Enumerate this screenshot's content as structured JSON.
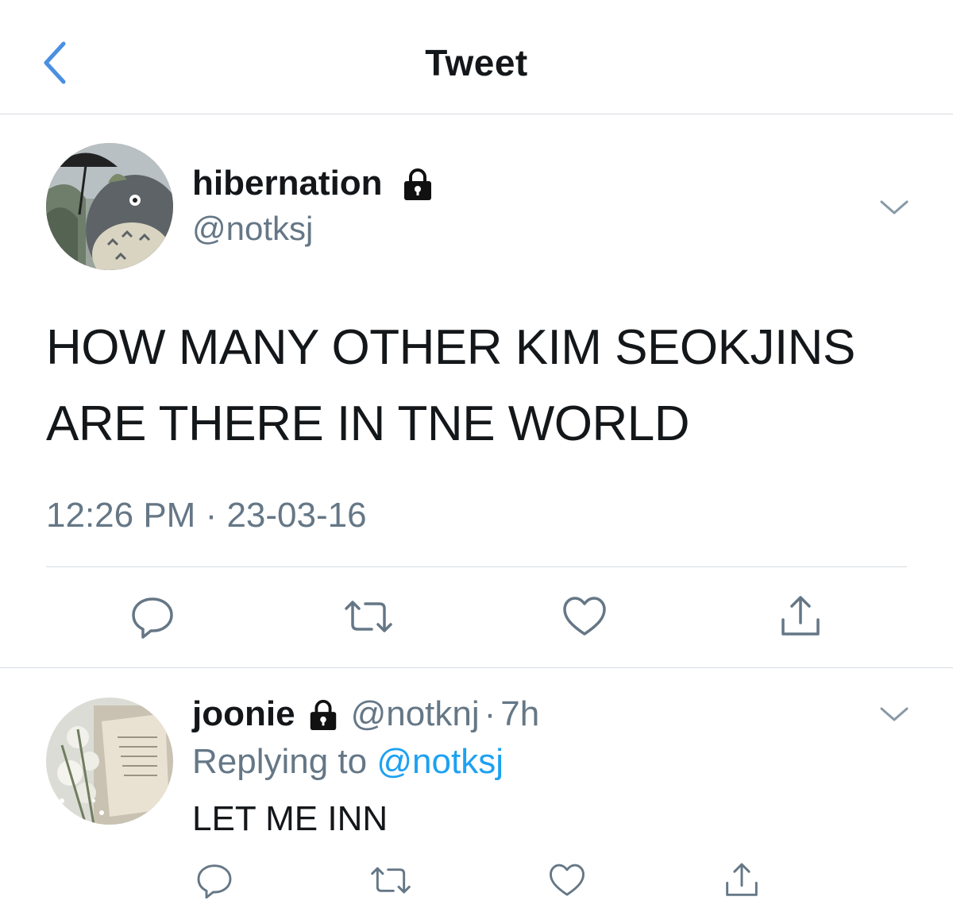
{
  "header": {
    "title": "Tweet",
    "back_icon": "chevron-left-icon"
  },
  "colors": {
    "accent": "#1da1f2",
    "back": "#4a90e2",
    "secondary_text": "#657786",
    "divider": "#d6dadf"
  },
  "main_tweet": {
    "display_name": "hibernation",
    "protected_icon": "lock-icon",
    "handle": "@notksj",
    "menu_icon": "chevron-down-icon",
    "text_line1": "HOW MANY OTHER KIM SEOKJINS",
    "text_line2": "ARE THERE IN TNE WORLD",
    "time": "12:26 PM",
    "separator": " · ",
    "date": "23-03-16",
    "actions": [
      "reply-icon",
      "retweet-icon",
      "like-icon",
      "share-icon"
    ]
  },
  "reply": {
    "display_name": "joonie",
    "protected_icon": "lock-icon",
    "handle": "@notknj",
    "dot": "·",
    "time": "7h",
    "menu_icon": "chevron-down-icon",
    "replying_to_label": "Replying to",
    "replying_to_handle": "@notksj",
    "text": "LET ME INN",
    "actions": [
      "reply-icon",
      "retweet-icon",
      "like-icon",
      "share-icon"
    ]
  }
}
